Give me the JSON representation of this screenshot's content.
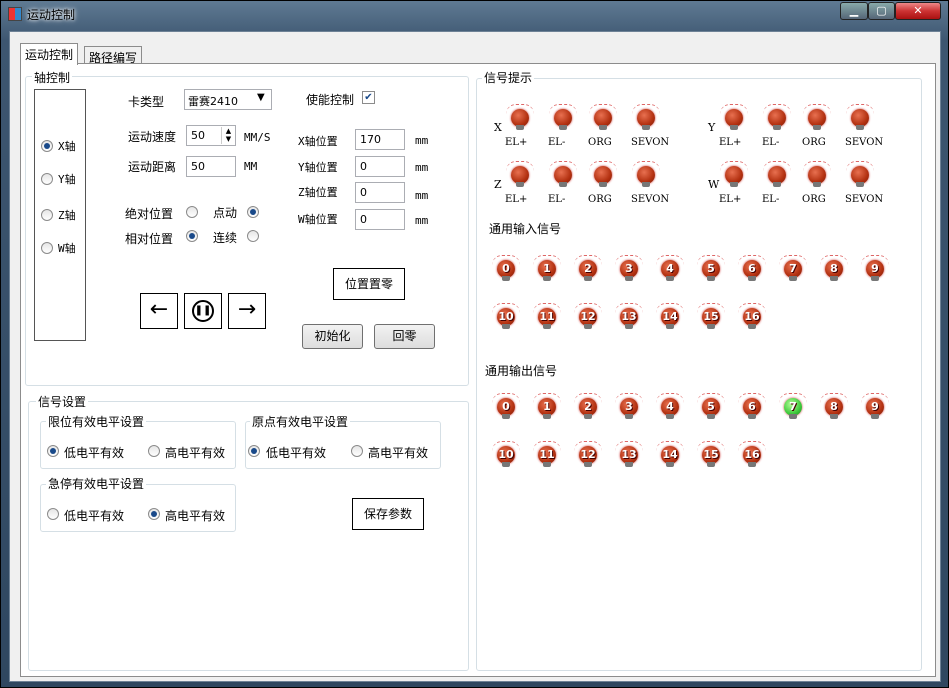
{
  "window": {
    "title": "运动控制"
  },
  "caption_buttons": {
    "minimize": "▁",
    "maximize": "▢",
    "close": "✕"
  },
  "tabs": [
    "运动控制",
    "路径编写"
  ],
  "axis_group": {
    "title": "轴控制",
    "axes": [
      {
        "label": "X轴",
        "selected": true
      },
      {
        "label": "Y轴",
        "selected": false
      },
      {
        "label": "Z轴",
        "selected": false
      },
      {
        "label": "W轴",
        "selected": false
      }
    ],
    "card_type_label": "卡类型",
    "card_type_value": "雷赛2410",
    "enable_label": "使能控制",
    "enable_checked": true,
    "speed_label": "运动速度",
    "speed_value": "50",
    "speed_unit": "MM/S",
    "distance_label": "运动距离",
    "distance_value": "50",
    "distance_unit": "MM",
    "abs_label": "绝对位置",
    "rel_label": "相对位置",
    "jog_label": "点动",
    "cont_label": "连续",
    "positions": [
      {
        "label": "X轴位置",
        "value": "170",
        "unit": "mm"
      },
      {
        "label": "Y轴位置",
        "value": "0",
        "unit": "mm"
      },
      {
        "label": "Z轴位置",
        "value": "0",
        "unit": "mm"
      },
      {
        "label": "W轴位置",
        "value": "0",
        "unit": "mm"
      }
    ],
    "zero_pos_button": "位置置零",
    "init_button": "初始化",
    "home_button": "回零",
    "left_arrow": "←",
    "right_arrow": "→",
    "pause_symbol": "⏸"
  },
  "signal_settings": {
    "title": "信号设置",
    "limit": {
      "title": "限位有效电平设置",
      "low": "低电平有效",
      "high": "高电平有效",
      "selected": "low"
    },
    "origin": {
      "title": "原点有效电平设置",
      "low": "低电平有效",
      "high": "高电平有效",
      "selected": "low"
    },
    "estop": {
      "title": "急停有效电平设置",
      "low": "低电平有效",
      "high": "高电平有效",
      "selected": "high"
    },
    "save_button": "保存参数"
  },
  "signal_hints": {
    "title": "信号提示",
    "axes": [
      {
        "name": "X",
        "labels": [
          "EL+",
          "EL-",
          "ORG",
          "SEVON"
        ]
      },
      {
        "name": "Y",
        "labels": [
          "EL+",
          "EL-",
          "ORG",
          "SEVON"
        ]
      },
      {
        "name": "Z",
        "labels": [
          "EL+",
          "EL-",
          "ORG",
          "SEVON"
        ]
      },
      {
        "name": "W",
        "labels": [
          "EL+",
          "EL-",
          "ORG",
          "SEVON"
        ]
      }
    ],
    "input_title": "通用输入信号",
    "inputs": [
      "0",
      "1",
      "2",
      "3",
      "4",
      "5",
      "6",
      "7",
      "8",
      "9",
      "10",
      "11",
      "12",
      "13",
      "14",
      "15",
      "16"
    ],
    "output_title": "通用输出信号",
    "outputs": [
      "0",
      "1",
      "2",
      "3",
      "4",
      "5",
      "6",
      "7",
      "8",
      "9",
      "10",
      "11",
      "12",
      "13",
      "14",
      "15",
      "16"
    ],
    "output_on": [
      7
    ],
    "colors": {
      "off": "#b23010",
      "on": "#3cc83a"
    }
  }
}
